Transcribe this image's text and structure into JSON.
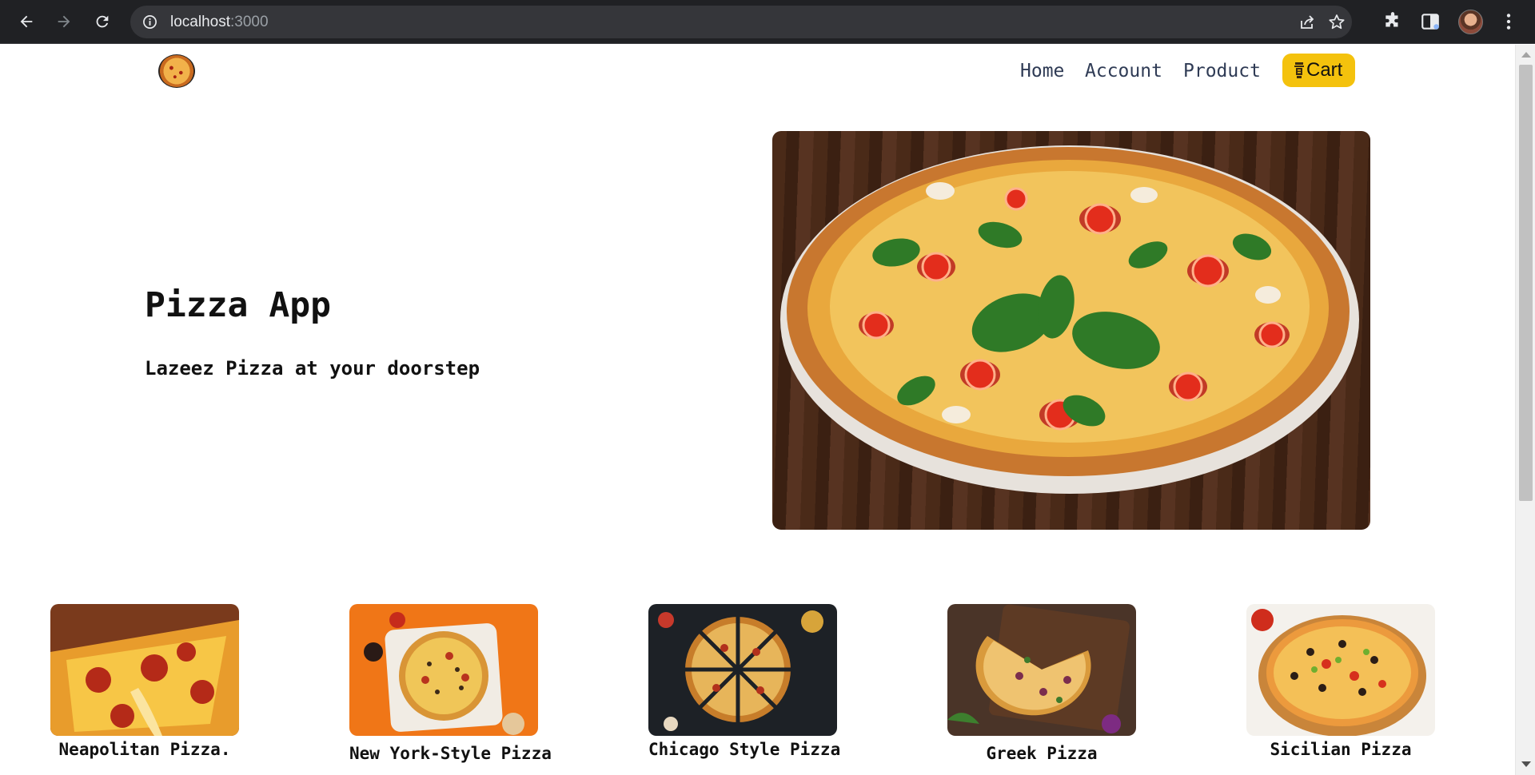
{
  "browser": {
    "url_host": "localhost",
    "url_port": ":3000",
    "icons": [
      "back-icon",
      "forward-icon",
      "reload-icon",
      "info-icon",
      "share-icon",
      "star-icon",
      "extensions-icon",
      "sidepanel-icon",
      "profile-avatar",
      "menu-icon"
    ]
  },
  "nav": {
    "links": [
      "Home",
      "Account",
      "Product"
    ],
    "cart_label": "Cart",
    "cart_color": "#f4c20d",
    "link_color": "#2f3b55"
  },
  "hero": {
    "title": "Pizza App",
    "subtitle": "Lazeez Pizza at your doorstep"
  },
  "products": [
    {
      "name": "Neapolitan Pizza."
    },
    {
      "name": "New York-Style Pizza"
    },
    {
      "name": "Chicago Style Pizza"
    },
    {
      "name": "Greek Pizza"
    },
    {
      "name": "Sicilian Pizza"
    }
  ]
}
